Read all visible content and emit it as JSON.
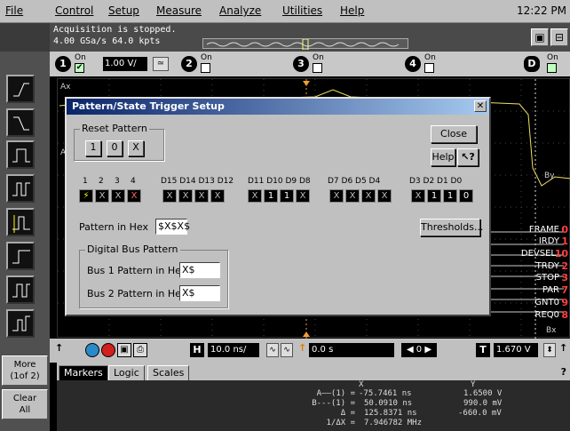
{
  "menu": {
    "items": [
      "File",
      "Control",
      "Setup",
      "Measure",
      "Analyze",
      "Utilities",
      "Help"
    ],
    "clock": "12:22 PM"
  },
  "status": {
    "line1": "Acquisition is stopped.",
    "line2": "4.00 GSa/s  64.0 kpts"
  },
  "channels": {
    "on_label": "On",
    "ch1": {
      "num": "1",
      "volts": "1.00 V/",
      "checked": "✔"
    },
    "ch2": {
      "num": "2"
    },
    "ch3": {
      "num": "3"
    },
    "ch4": {
      "num": "4"
    },
    "digital": {
      "num": "D"
    }
  },
  "left_toolbar": {
    "more": "More\n(1of 2)",
    "clear": "Clear\nAll"
  },
  "dialog": {
    "title": "Pattern/State Trigger Setup",
    "reset_group": "Reset Pattern",
    "reset_buttons": [
      "1",
      "0",
      "X"
    ],
    "close": "Close",
    "help": "Help",
    "help_arrow": "↖?",
    "analog_labels": [
      "1",
      "2",
      "3",
      "4"
    ],
    "digital_labels": [
      "D15 D14 D13 D12",
      "D11 D10 D9 D8",
      "D7 D6 D5 D4",
      "D3 D2 D1 D0"
    ],
    "bits_analog": [
      "⚡",
      "X",
      "X",
      "X"
    ],
    "bits_group1": [
      "X",
      "X",
      "X",
      "X"
    ],
    "bits_group2": [
      "X",
      "1",
      "1",
      "X"
    ],
    "bits_group3": [
      "X",
      "X",
      "X",
      "X"
    ],
    "bits_group4": [
      "X",
      "1",
      "1",
      "0"
    ],
    "pattern_hex_label": "Pattern in Hex",
    "pattern_hex_value": "$X$X$",
    "thresholds": "Thresholds...",
    "bus_group": "Digital Bus Pattern",
    "bus1_label": "Bus 1 Pattern in Hex",
    "bus1_value": "X$",
    "bus2_label": "Bus 2 Pattern in Hex",
    "bus2_value": "X$"
  },
  "signals": [
    {
      "name": "FRAME",
      "num": "0"
    },
    {
      "name": "IRDY",
      "num": "1"
    },
    {
      "name": "DEVSEL",
      "num": "10"
    },
    {
      "name": "TRDY",
      "num": "2"
    },
    {
      "name": "STOP",
      "num": "3"
    },
    {
      "name": "PAR",
      "num": "7"
    },
    {
      "name": "GNT0",
      "num": "9"
    },
    {
      "name": "REQ0",
      "num": "8"
    }
  ],
  "graticule_labels": {
    "ay_left": "Ay",
    "ax_left": "Ax",
    "by_right": "By",
    "bx_bottom": "Bx"
  },
  "timebase": {
    "h_label": "H",
    "time_per_div": "10.0 ns/",
    "delay": "0.0 s",
    "t_label": "T",
    "trigger_level": "1.670 V"
  },
  "markers": {
    "tabs": [
      "Markers",
      "Logic",
      "Scales"
    ],
    "help_q": "?",
    "header_x": "X",
    "header_y": "Y",
    "rows": [
      {
        "label": "A——(1) =",
        "x": "-75.7461 ns",
        "y": "1.6500 V"
      },
      {
        "label": "B---(1) =",
        "x": "50.0910 ns",
        "y": "990.0 mV"
      },
      {
        "label": "Δ =",
        "x": "125.8371 ns",
        "y": "-660.0 mV"
      },
      {
        "label": "1/ΔX =",
        "x": "7.946782 MHz",
        "y": ""
      }
    ]
  },
  "colors": {
    "accent": "#0a246a",
    "signal_red": "#ff4040",
    "trace_yellow": "#f0e060"
  }
}
